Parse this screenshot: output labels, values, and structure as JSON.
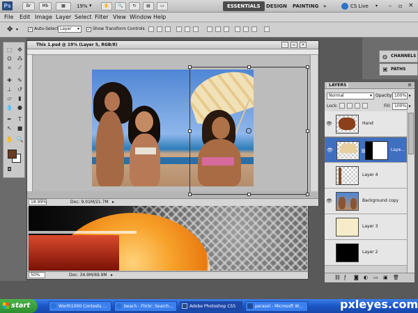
{
  "app": {
    "logo": "Ps",
    "br_label": "Br",
    "mb_label": "Mb",
    "zoom": "19%",
    "workspaces": [
      "ESSENTIALS",
      "DESIGN",
      "PAINTING"
    ],
    "overflow": "»",
    "cs_live": "CS Live"
  },
  "menus": [
    "File",
    "Edit",
    "Image",
    "Layer",
    "Select",
    "Filter",
    "View",
    "Window",
    "Help"
  ],
  "options": {
    "auto_select_label": "Auto-Select:",
    "auto_select_value": "Layer",
    "show_transform_label": "Show Transform Controls"
  },
  "doc1": {
    "title": "This 1.psd @ 19% (Layer 5, RGB/8)",
    "zoom": "18.99%",
    "doc_info": "Doc: 9.01M/21.7M"
  },
  "doc2": {
    "zoom": "50%",
    "doc_info": "Doc: 34.9M/69.9M"
  },
  "dock": {
    "channels": "CHANNELS",
    "paths": "PATHS"
  },
  "layers_panel": {
    "tab": "LAYERS",
    "blend_mode": "Normal",
    "opacity_label": "Opacity:",
    "opacity": "100%",
    "lock_label": "Lock:",
    "fill_label": "Fill:",
    "fill": "100%",
    "layers": [
      {
        "name": "Hand",
        "visible": true,
        "selected": false
      },
      {
        "name": "Laye...",
        "visible": true,
        "selected": true
      },
      {
        "name": "Layer 4",
        "visible": false,
        "selected": false
      },
      {
        "name": "Background copy",
        "visible": true,
        "selected": false
      },
      {
        "name": "Layer 3",
        "visible": false,
        "selected": false
      },
      {
        "name": "Layer 2",
        "visible": false,
        "selected": false
      }
    ]
  },
  "taskbar": {
    "start": "start",
    "tasks": [
      {
        "label": "Worth1000 Contests ...",
        "active": false
      },
      {
        "label": "beach - Flickr: Search...",
        "active": false
      },
      {
        "label": "Adobe Photoshop CS5",
        "active": true
      },
      {
        "label": "parasol - Microsoft W...",
        "active": false
      }
    ]
  },
  "watermark": "pxleyes.com",
  "colors": {
    "foreground": "#6a3a24",
    "background": "#ffffff",
    "selection": "#3f6fbf"
  }
}
